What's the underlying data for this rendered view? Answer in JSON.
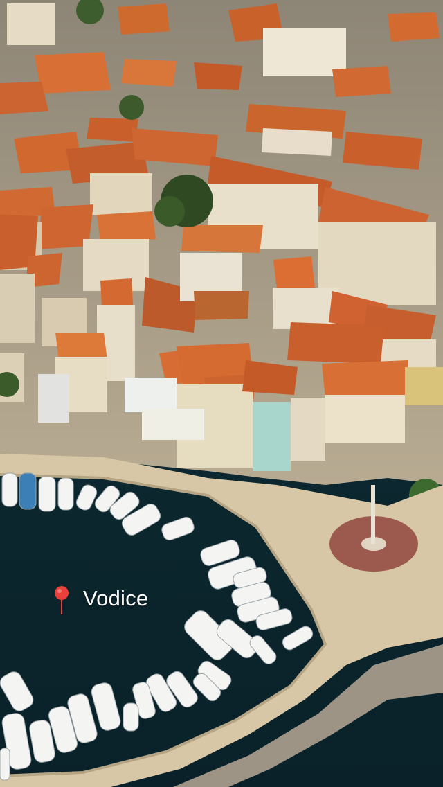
{
  "location": {
    "name": "Vodice",
    "pin_icon": "map-pin-icon",
    "pin_color": "#e8413b"
  },
  "photo": {
    "subject": "aerial-town-harbor"
  },
  "colors": {
    "sea": "#0e2d35",
    "roof": "#d0692f",
    "promenade": "#d9c8a8",
    "wall": "#e8dcc4"
  }
}
